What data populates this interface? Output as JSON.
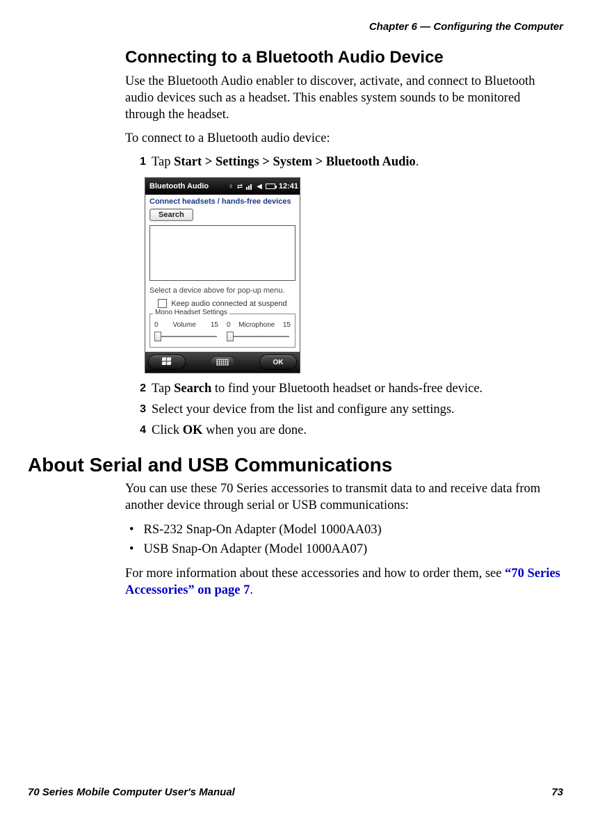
{
  "header": {
    "chapter": "Chapter 6 — Configuring the Computer"
  },
  "section1": {
    "title": "Connecting to a Bluetooth Audio Device",
    "p1": "Use the Bluetooth Audio enabler to discover, activate, and connect to Bluetooth audio devices such as a headset. This enables system sounds to be monitored through the headset.",
    "p2": "To connect to a Bluetooth audio device:",
    "steps": {
      "s1": {
        "num": "1",
        "text_pre": "Tap ",
        "bold": "Start > Settings > System > Bluetooth Audio",
        "text_post": "."
      },
      "s2": {
        "num": "2",
        "text_pre": "Tap ",
        "bold": "Search",
        "text_post": " to find your Bluetooth headset or hands-free device."
      },
      "s3": {
        "num": "3",
        "text": "Select your device from the list and configure any settings."
      },
      "s4": {
        "num": "4",
        "text_pre": "Click ",
        "bold": "OK",
        "text_post": " when you are done."
      }
    }
  },
  "screenshot": {
    "titlebar": {
      "title": "Bluetooth Audio",
      "time": "12:41"
    },
    "heading": "Connect headsets / hands-free devices",
    "search_btn": "Search",
    "hint": "Select a device above for pop-up menu.",
    "checkbox_label": "Keep audio connected at suspend",
    "group_legend": "Mono Headset Settings",
    "slider_volume": {
      "min": "0",
      "label": "Volume",
      "max": "15"
    },
    "slider_mic": {
      "min": "0",
      "label": "Microphone",
      "max": "15"
    },
    "ok_btn": "OK"
  },
  "section2": {
    "title": "About Serial and USB Communications",
    "p1": "You can use these 70 Series accessories to transmit data to and receive data from another device through serial or USB communications:",
    "bullets": {
      "b1": "RS-232 Snap-On Adapter (Model 1000AA03)",
      "b2": "USB Snap-On Adapter (Model 1000AA07)"
    },
    "p2_pre": " For more information about these accessories and how to order them, see ",
    "p2_link": "“70 Series Accessories” on page 7",
    "p2_post": "."
  },
  "footer": {
    "manual": "70 Series Mobile Computer User's Manual",
    "page": "73"
  }
}
